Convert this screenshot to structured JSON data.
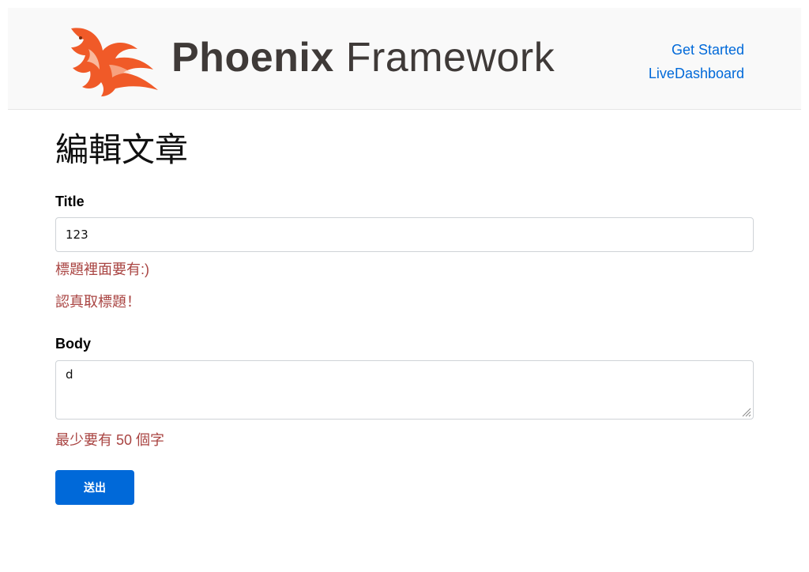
{
  "header": {
    "logo_bold": "Phoenix",
    "logo_regular": "Framework",
    "logo_icon": "phoenix-bird-icon",
    "nav": [
      {
        "label": "Get Started"
      },
      {
        "label": "LiveDashboard"
      }
    ]
  },
  "form": {
    "heading": "編輯文章",
    "title_label": "Title",
    "title_value": "123",
    "title_errors": [
      "標題裡面要有:)",
      "認真取標題！"
    ],
    "body_label": "Body",
    "body_value": "d",
    "body_errors": [
      "最少要有 50 個字"
    ],
    "submit_label": "送出"
  },
  "colors": {
    "link": "#0069d9",
    "error": "#a94442",
    "button": "#0069d9",
    "logo_orange": "#f05a28"
  }
}
